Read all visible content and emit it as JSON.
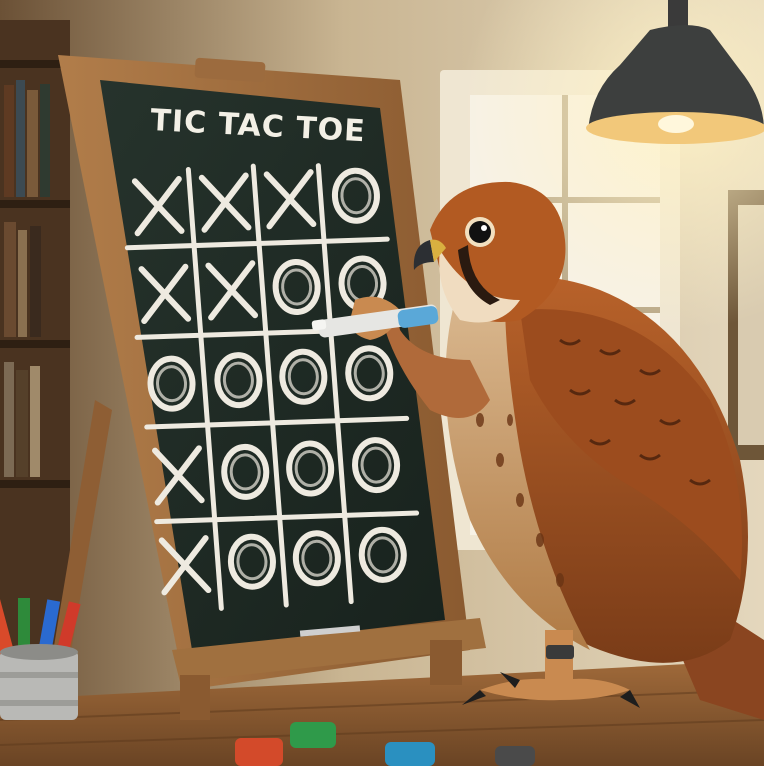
{
  "scene": {
    "board_title": "TIC TAC TOE",
    "board_cells": [
      [
        "X",
        "X",
        "X",
        "O"
      ],
      [
        "X",
        "X",
        "O",
        "O"
      ],
      [
        "O",
        "O",
        "O",
        "O"
      ],
      [
        "X",
        "O",
        "O",
        "O"
      ],
      [
        "X",
        "O",
        "O",
        "O"
      ]
    ],
    "subjects": [
      "kestrel-bird",
      "chalkboard",
      "chalk-marker",
      "pencil-cup",
      "pendant-lamp",
      "window",
      "bookshelf",
      "wooden-desk"
    ],
    "colors": {
      "board": "#1e2a24",
      "frame": "#9a6a3c",
      "feather": "#a4521f",
      "wall": "#d8c7a8",
      "desk": "#8a5a32"
    }
  }
}
